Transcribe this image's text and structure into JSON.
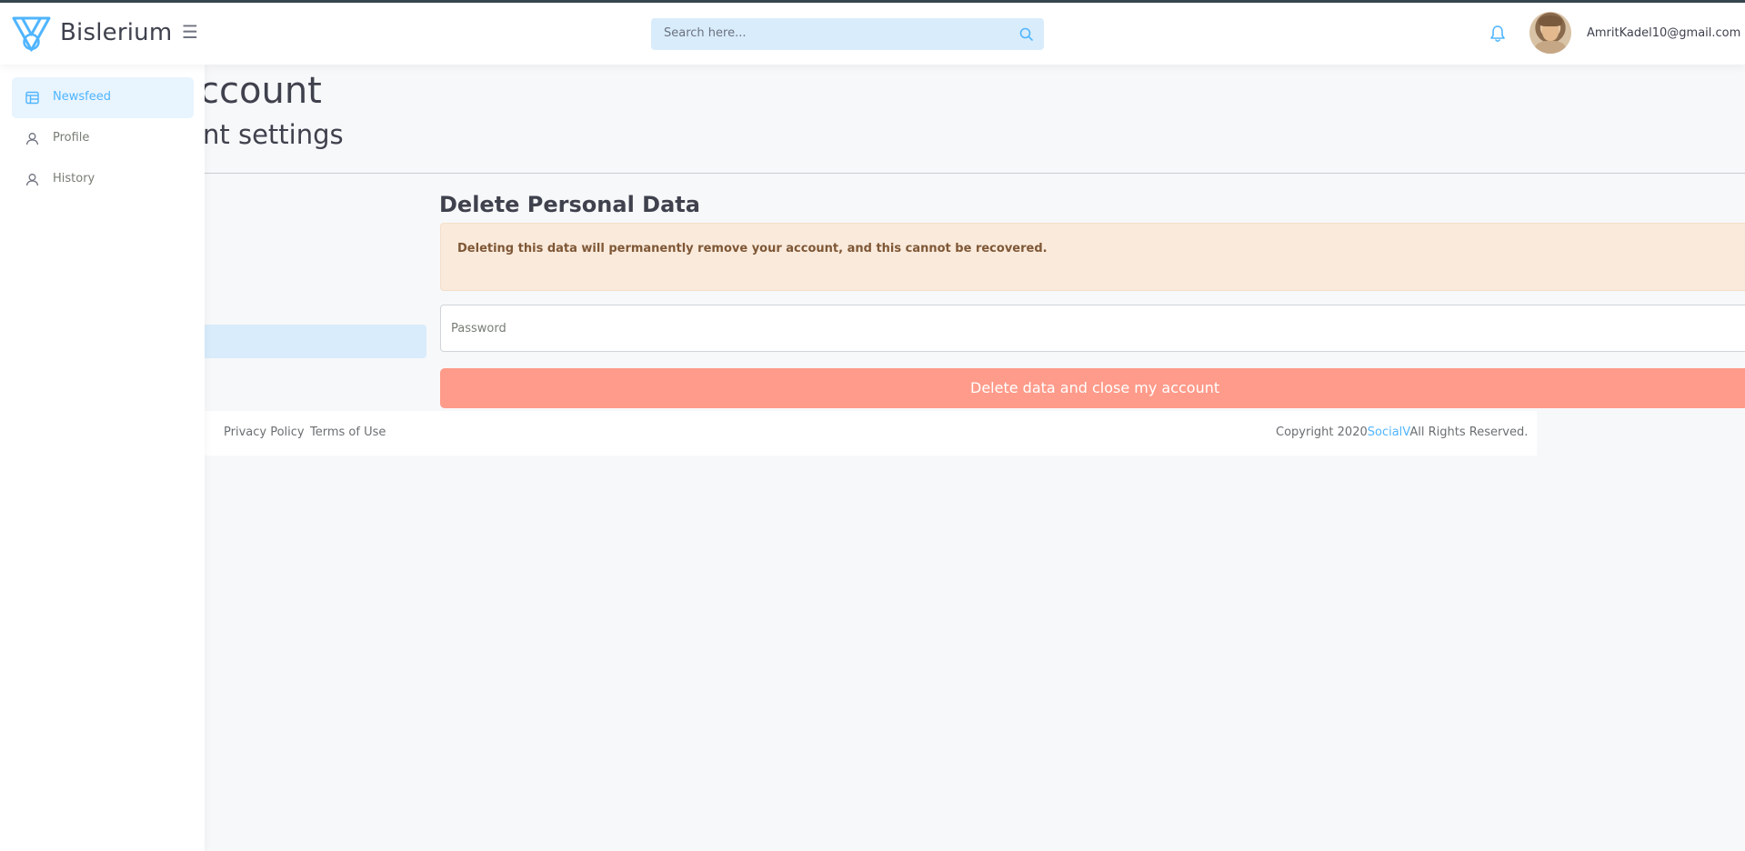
{
  "header": {
    "brand": "Bislerium",
    "search_placeholder": "Search here...",
    "user_email": "AmritKadel10@gmail.com"
  },
  "sidebar": {
    "items": [
      {
        "label": "Newsfeed",
        "icon": "newsfeed-icon",
        "active": true
      },
      {
        "label": "Profile",
        "icon": "user-icon",
        "active": false
      },
      {
        "label": "History",
        "icon": "user-icon",
        "active": false
      }
    ]
  },
  "page": {
    "title_partial": "ur account",
    "subtitle_partial": "ccount settings"
  },
  "delete_section": {
    "title": "Delete Personal Data",
    "warning": "Deleting this data will permanently remove your account, and this cannot be recovered.",
    "password_placeholder": "Password",
    "button_label": "Delete data and close my account"
  },
  "footer": {
    "privacy": "Privacy Policy",
    "terms": "Terms of Use",
    "copyright_prefix": "Copyright 2020",
    "copyright_brand": "SocialV",
    "copyright_suffix": "All Rights Reserved."
  },
  "colors": {
    "accent": "#50b5ff",
    "danger": "#ff9b8a",
    "warning_bg": "#faeadb"
  }
}
